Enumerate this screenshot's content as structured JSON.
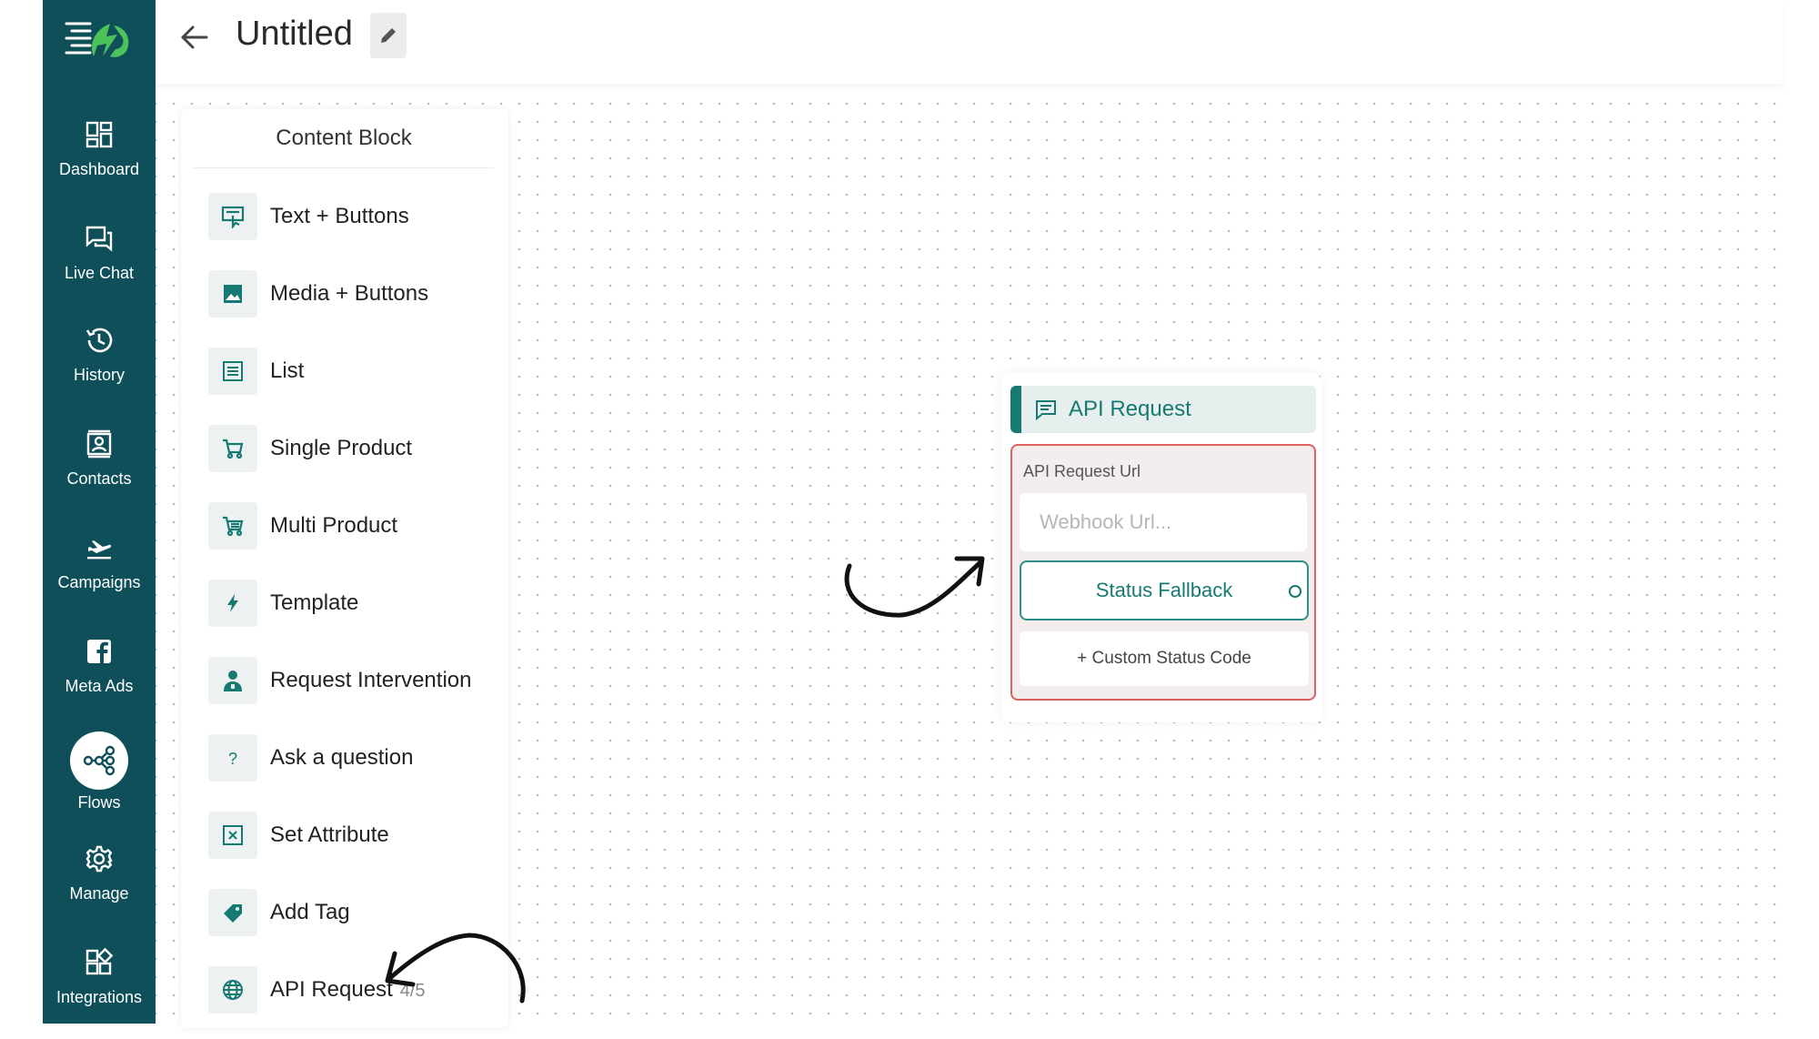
{
  "sidebar": {
    "logo": "chatflow-logo",
    "items": [
      {
        "label": "Dashboard",
        "icon": "dashboard-icon"
      },
      {
        "label": "Live Chat",
        "icon": "chat-icon"
      },
      {
        "label": "History",
        "icon": "history-icon"
      },
      {
        "label": "Contacts",
        "icon": "contacts-icon"
      },
      {
        "label": "Campaigns",
        "icon": "plane-icon"
      },
      {
        "label": "Meta Ads",
        "icon": "facebook-icon"
      },
      {
        "label": "Flows",
        "icon": "flows-icon",
        "active": true
      },
      {
        "label": "Manage",
        "icon": "gear-icon"
      },
      {
        "label": "Integrations",
        "icon": "integrations-icon"
      }
    ]
  },
  "header": {
    "title": "Untitled",
    "back_icon": "arrow-left-icon",
    "edit_icon": "pencil-icon"
  },
  "panel": {
    "title": "Content Block",
    "blocks": [
      {
        "label": "Text + Buttons",
        "icon": "text-buttons-icon"
      },
      {
        "label": "Media + Buttons",
        "icon": "image-icon"
      },
      {
        "label": "List",
        "icon": "list-icon"
      },
      {
        "label": "Single Product",
        "icon": "cart-icon"
      },
      {
        "label": "Multi Product",
        "icon": "cart-icon"
      },
      {
        "label": "Template",
        "icon": "bolt-icon"
      },
      {
        "label": "Request Intervention",
        "icon": "agent-icon"
      },
      {
        "label": "Ask a question",
        "icon": "question-icon"
      },
      {
        "label": "Set Attribute",
        "icon": "attribute-icon"
      },
      {
        "label": "Add Tag",
        "icon": "tag-icon"
      },
      {
        "label": "API Request",
        "icon": "globe-icon",
        "count": "4/5"
      }
    ]
  },
  "node": {
    "title": "API Request",
    "url_label": "API Request Url",
    "url_placeholder": "Webhook Url...",
    "fallback_label": "Status Fallback",
    "custom_label": "+ Custom Status Code"
  },
  "colors": {
    "sidebar": "#0f4f5a",
    "accent": "#177a72",
    "error_border": "#e05f5f"
  }
}
